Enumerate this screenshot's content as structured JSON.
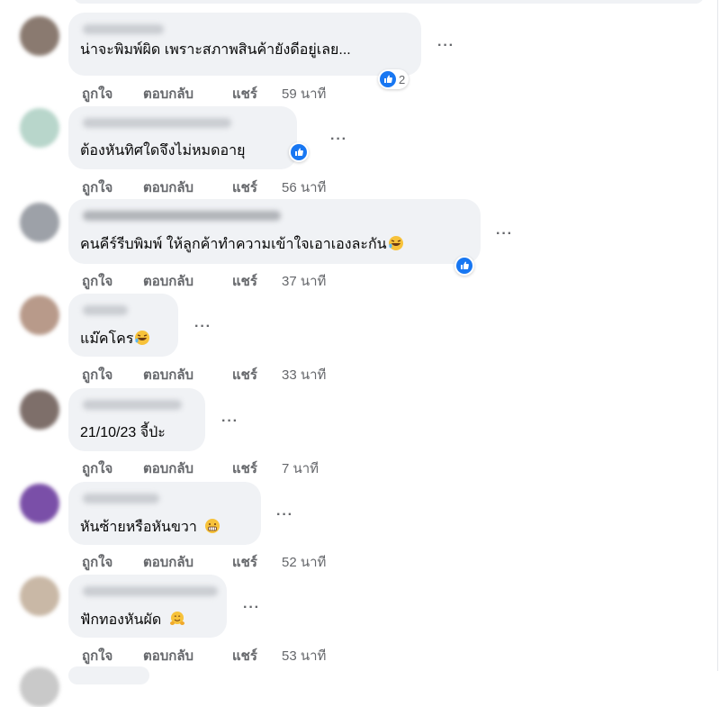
{
  "actions": {
    "like": "ถูกใจ",
    "reply": "ตอบกลับ",
    "share": "แชร์"
  },
  "colors": {
    "bubble": "#f0f2f5",
    "meta_text": "#65676b",
    "like_blue": "#1877f2"
  },
  "comments": [
    {
      "text": "น่าจะพิมพ์ผิด เพราะสภาพสินค้ายังดีอยู่เลย...",
      "time": "59 นาที",
      "reactions": {
        "icon": "like-icon",
        "count": "2"
      }
    },
    {
      "text": "ต้องหันทิศใดจึงไม่หมดอายุ",
      "time": "56 นาที",
      "reactions": {
        "icon": "like-icon"
      }
    },
    {
      "text": "คนคีร์รีบพิมพ์ ให้ลูกค้าทำความเข้าใจเอาเองละกัน",
      "emoji": "rofl-emoji",
      "time": "37 นาที",
      "reactions": {
        "icon": "like-icon"
      }
    },
    {
      "text": "แม๊คโคร",
      "emoji": "rofl-emoji",
      "time": "33 นาที"
    },
    {
      "text": "21/10/23 จี้ป่ะ",
      "time": "7 นาที"
    },
    {
      "text": "หันซ้ายหรือหันขวา",
      "emoji": "grimace-emoji",
      "time": "52 นาที"
    },
    {
      "text": "ฟักทองหันผัด",
      "emoji": "hugging-emoji",
      "time": "53 นาที"
    }
  ]
}
